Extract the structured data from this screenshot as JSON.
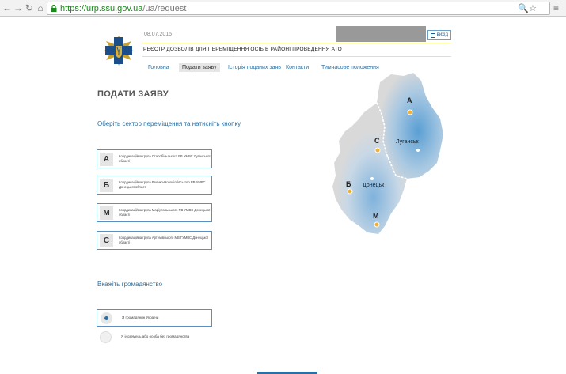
{
  "browser": {
    "url_host": "https://urp.ssu.gov.ua",
    "url_path": "/ua/request"
  },
  "header": {
    "date": "08.07.2015",
    "exit_label": "вихід",
    "registry_title": "РЕЄСТР ДОЗВОЛІВ ДЛЯ ПЕРЕМІЩЕННЯ ОСІБ В РАЙОНІ ПРОВЕДЕННЯ АТО"
  },
  "menu": {
    "items": [
      {
        "label": "Головна"
      },
      {
        "label": "Подати заяву"
      },
      {
        "label": "Історія поданих заяв"
      },
      {
        "label": "Контакти"
      },
      {
        "label": "Тимчасове положення"
      }
    ]
  },
  "main": {
    "heading": "ПОДАТИ ЗАЯВУ",
    "instruction": "Оберіть сектор переміщення та натисніть кнопку",
    "sectors": [
      {
        "letter": "А",
        "text": "Координаційна група Старобільського РВ УМВС Луганської області"
      },
      {
        "letter": "Б",
        "text": "Координаційна група Велико-Новосілківського РВ УМВС Донецької області"
      },
      {
        "letter": "М",
        "text": "Координаційна група Маріупольського РВ УМВС Донецької області"
      },
      {
        "letter": "С",
        "text": "Координаційна група Артемівського МВ ГУМВС Донецької області"
      }
    ],
    "citizenship_heading": "Вкажіть громадянство",
    "citizenship_options": [
      {
        "label": "Я громадянин України",
        "selected": true
      },
      {
        "label": "Я іноземець або особа без громадянства",
        "selected": false
      }
    ]
  },
  "map": {
    "sector_labels": [
      "А",
      "С",
      "Б",
      "М"
    ],
    "cities": [
      "Луганськ",
      "Донецьк"
    ],
    "colors": {
      "region_fill": "#d9d9d9",
      "highlight": "#5a9fd4",
      "marker": "#f0b030"
    }
  }
}
